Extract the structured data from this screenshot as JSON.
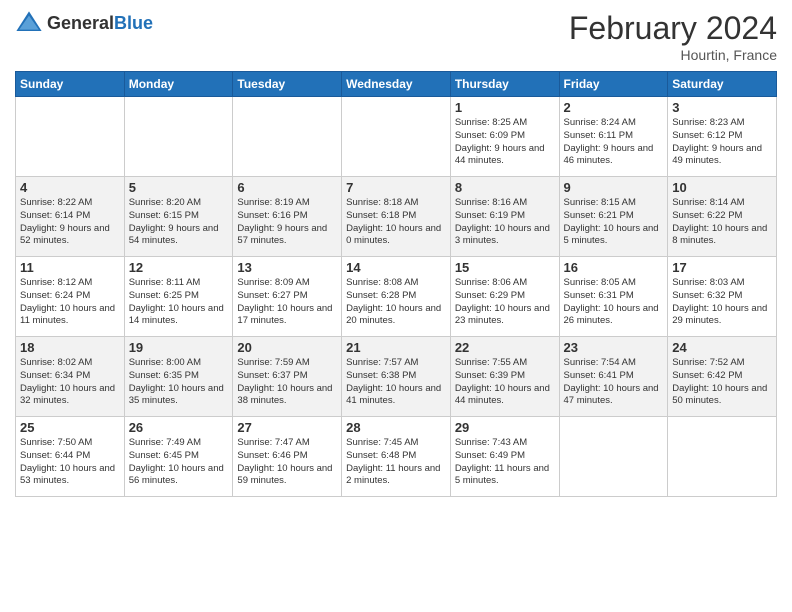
{
  "header": {
    "logo_general": "General",
    "logo_blue": "Blue",
    "month_year": "February 2024",
    "location": "Hourtin, France"
  },
  "calendar": {
    "days_of_week": [
      "Sunday",
      "Monday",
      "Tuesday",
      "Wednesday",
      "Thursday",
      "Friday",
      "Saturday"
    ],
    "weeks": [
      [
        {
          "day": "",
          "info": ""
        },
        {
          "day": "",
          "info": ""
        },
        {
          "day": "",
          "info": ""
        },
        {
          "day": "",
          "info": ""
        },
        {
          "day": "1",
          "info": "Sunrise: 8:25 AM\nSunset: 6:09 PM\nDaylight: 9 hours and 44 minutes."
        },
        {
          "day": "2",
          "info": "Sunrise: 8:24 AM\nSunset: 6:11 PM\nDaylight: 9 hours and 46 minutes."
        },
        {
          "day": "3",
          "info": "Sunrise: 8:23 AM\nSunset: 6:12 PM\nDaylight: 9 hours and 49 minutes."
        }
      ],
      [
        {
          "day": "4",
          "info": "Sunrise: 8:22 AM\nSunset: 6:14 PM\nDaylight: 9 hours and 52 minutes."
        },
        {
          "day": "5",
          "info": "Sunrise: 8:20 AM\nSunset: 6:15 PM\nDaylight: 9 hours and 54 minutes."
        },
        {
          "day": "6",
          "info": "Sunrise: 8:19 AM\nSunset: 6:16 PM\nDaylight: 9 hours and 57 minutes."
        },
        {
          "day": "7",
          "info": "Sunrise: 8:18 AM\nSunset: 6:18 PM\nDaylight: 10 hours and 0 minutes."
        },
        {
          "day": "8",
          "info": "Sunrise: 8:16 AM\nSunset: 6:19 PM\nDaylight: 10 hours and 3 minutes."
        },
        {
          "day": "9",
          "info": "Sunrise: 8:15 AM\nSunset: 6:21 PM\nDaylight: 10 hours and 5 minutes."
        },
        {
          "day": "10",
          "info": "Sunrise: 8:14 AM\nSunset: 6:22 PM\nDaylight: 10 hours and 8 minutes."
        }
      ],
      [
        {
          "day": "11",
          "info": "Sunrise: 8:12 AM\nSunset: 6:24 PM\nDaylight: 10 hours and 11 minutes."
        },
        {
          "day": "12",
          "info": "Sunrise: 8:11 AM\nSunset: 6:25 PM\nDaylight: 10 hours and 14 minutes."
        },
        {
          "day": "13",
          "info": "Sunrise: 8:09 AM\nSunset: 6:27 PM\nDaylight: 10 hours and 17 minutes."
        },
        {
          "day": "14",
          "info": "Sunrise: 8:08 AM\nSunset: 6:28 PM\nDaylight: 10 hours and 20 minutes."
        },
        {
          "day": "15",
          "info": "Sunrise: 8:06 AM\nSunset: 6:29 PM\nDaylight: 10 hours and 23 minutes."
        },
        {
          "day": "16",
          "info": "Sunrise: 8:05 AM\nSunset: 6:31 PM\nDaylight: 10 hours and 26 minutes."
        },
        {
          "day": "17",
          "info": "Sunrise: 8:03 AM\nSunset: 6:32 PM\nDaylight: 10 hours and 29 minutes."
        }
      ],
      [
        {
          "day": "18",
          "info": "Sunrise: 8:02 AM\nSunset: 6:34 PM\nDaylight: 10 hours and 32 minutes."
        },
        {
          "day": "19",
          "info": "Sunrise: 8:00 AM\nSunset: 6:35 PM\nDaylight: 10 hours and 35 minutes."
        },
        {
          "day": "20",
          "info": "Sunrise: 7:59 AM\nSunset: 6:37 PM\nDaylight: 10 hours and 38 minutes."
        },
        {
          "day": "21",
          "info": "Sunrise: 7:57 AM\nSunset: 6:38 PM\nDaylight: 10 hours and 41 minutes."
        },
        {
          "day": "22",
          "info": "Sunrise: 7:55 AM\nSunset: 6:39 PM\nDaylight: 10 hours and 44 minutes."
        },
        {
          "day": "23",
          "info": "Sunrise: 7:54 AM\nSunset: 6:41 PM\nDaylight: 10 hours and 47 minutes."
        },
        {
          "day": "24",
          "info": "Sunrise: 7:52 AM\nSunset: 6:42 PM\nDaylight: 10 hours and 50 minutes."
        }
      ],
      [
        {
          "day": "25",
          "info": "Sunrise: 7:50 AM\nSunset: 6:44 PM\nDaylight: 10 hours and 53 minutes."
        },
        {
          "day": "26",
          "info": "Sunrise: 7:49 AM\nSunset: 6:45 PM\nDaylight: 10 hours and 56 minutes."
        },
        {
          "day": "27",
          "info": "Sunrise: 7:47 AM\nSunset: 6:46 PM\nDaylight: 10 hours and 59 minutes."
        },
        {
          "day": "28",
          "info": "Sunrise: 7:45 AM\nSunset: 6:48 PM\nDaylight: 11 hours and 2 minutes."
        },
        {
          "day": "29",
          "info": "Sunrise: 7:43 AM\nSunset: 6:49 PM\nDaylight: 11 hours and 5 minutes."
        },
        {
          "day": "",
          "info": ""
        },
        {
          "day": "",
          "info": ""
        }
      ]
    ]
  }
}
